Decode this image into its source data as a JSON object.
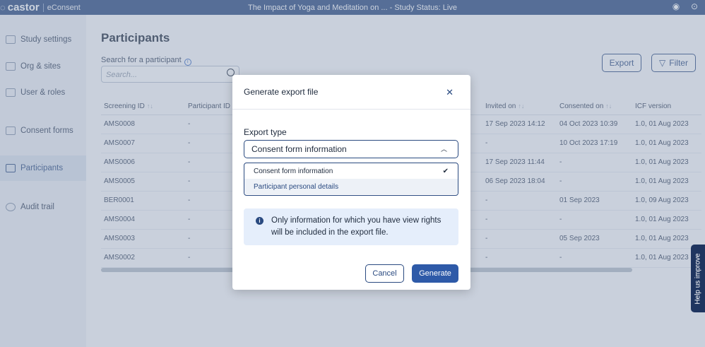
{
  "topbar": {
    "logo": "castor",
    "product": "eConsent",
    "title": "The Impact of Yoga and Meditation on ... - Study Status: Live",
    "icons": [
      "user-icon",
      "help-icon"
    ]
  },
  "sidebar": {
    "items": [
      {
        "label": "Study settings",
        "icon": "settings-icon",
        "active": false
      },
      {
        "label": "Org & sites",
        "icon": "building-icon",
        "active": false
      },
      {
        "label": "User & roles",
        "icon": "users-icon",
        "active": false
      },
      {
        "label": "Consent forms",
        "icon": "document-icon",
        "active": false
      },
      {
        "label": "Participants",
        "icon": "participants-icon",
        "active": true
      },
      {
        "label": "Audit trail",
        "icon": "history-icon",
        "active": false
      }
    ]
  },
  "page": {
    "title": "Participants",
    "search_label": "Search for a participant",
    "search_placeholder": "Search...",
    "export_label": "Export",
    "filter_label": "Filter"
  },
  "table": {
    "columns": [
      "Screening ID",
      "Participant ID",
      "",
      "",
      "Invited on",
      "Consented on",
      "ICF version"
    ],
    "rows": [
      [
        "AMS0008",
        "-",
        "",
        "",
        "17 Sep 2023 14:12",
        "04 Oct 2023 10:39",
        "1.0, 01 Aug 2023"
      ],
      [
        "AMS0007",
        "-",
        "",
        "",
        "-",
        "10 Oct 2023 17:19",
        "1.0, 01 Aug 2023"
      ],
      [
        "AMS0006",
        "-",
        "",
        "",
        "17 Sep 2023 11:44",
        "-",
        "1.0, 01 Aug 2023"
      ],
      [
        "AMS0005",
        "-",
        "",
        "",
        "06 Sep 2023 18:04",
        "-",
        "1.0, 01 Aug 2023"
      ],
      [
        "BER0001",
        "-",
        "",
        "",
        "-",
        "01 Sep 2023",
        "1.0, 09 Aug 2023"
      ],
      [
        "AMS0004",
        "-",
        "",
        "",
        "-",
        "-",
        "1.0, 01 Aug 2023"
      ],
      [
        "AMS0003",
        "-",
        "",
        "",
        "-",
        "05 Sep 2023",
        "1.0, 01 Aug 2023"
      ],
      [
        "AMS0002",
        "-",
        "",
        "",
        "-",
        "-",
        "1.0, 01 Aug 2023"
      ]
    ]
  },
  "modal": {
    "title": "Generate export file",
    "export_type_label": "Export type",
    "selected": "Consent form information",
    "options": [
      "Consent form information",
      "Participant personal details"
    ],
    "info": "Only information for which you have view rights will be included in the export file.",
    "cancel": "Cancel",
    "generate": "Generate"
  },
  "help_tab": "Help us improve",
  "colors": {
    "brand": "#2a4a80",
    "primary_button": "#2e5aa8"
  }
}
